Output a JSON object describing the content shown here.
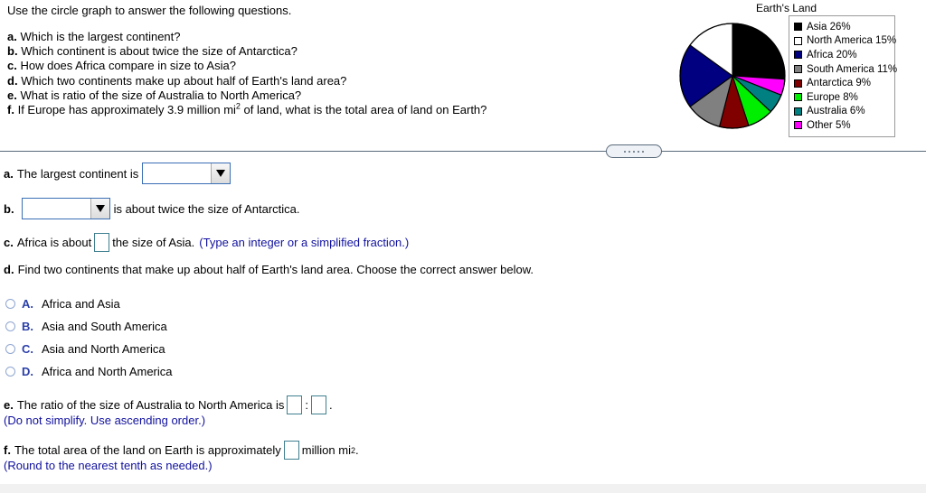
{
  "prompt": {
    "intro": "Use the circle graph to answer the following questions.",
    "questions": [
      {
        "label": "a.",
        "text": "Which is the largest continent?"
      },
      {
        "label": "b.",
        "text": "Which continent is about twice the size of Antarctica?"
      },
      {
        "label": "c.",
        "text": "How does Africa compare in size to Asia?"
      },
      {
        "label": "d.",
        "text": "Which two continents make up about half of Earth's land area?"
      },
      {
        "label": "e.",
        "text": "What is ratio of the size of Australia to North America?"
      },
      {
        "label": "f_pre",
        "text": "If Europe has approximately 3.9 million mi"
      },
      {
        "label": "f_post",
        "text": " of land, what is the total area of land on Earth?"
      }
    ],
    "f_label": "f.",
    "superscript": "2"
  },
  "chart_data": {
    "type": "pie",
    "title": "Earth's Land",
    "xlabel": "",
    "ylabel": "",
    "legend_position": "right",
    "grid": false,
    "start_angle_deg": 0,
    "direction": "clockwise",
    "categories": [
      "Asia",
      "Other",
      "Australia",
      "Europe",
      "Antarctica",
      "South America",
      "Africa",
      "North America"
    ],
    "values": [
      26,
      5,
      6,
      8,
      9,
      11,
      20,
      15
    ],
    "unit": "%",
    "legend_order": [
      "Asia",
      "North America",
      "Africa",
      "South America",
      "Antarctica",
      "Europe",
      "Australia",
      "Other"
    ],
    "legend_entries": [
      {
        "name": "Asia",
        "value": 26,
        "label": "Asia 26%",
        "color": "#000000"
      },
      {
        "name": "North America",
        "value": 15,
        "label": "North America 15%",
        "color": "#ffffff"
      },
      {
        "name": "Africa",
        "value": 20,
        "label": "Africa 20%",
        "color": "#000080"
      },
      {
        "name": "South America",
        "value": 11,
        "label": "South America 11%",
        "color": "#808080"
      },
      {
        "name": "Antarctica",
        "value": 9,
        "label": "Antarctica 9%",
        "color": "#800000"
      },
      {
        "name": "Europe",
        "value": 8,
        "label": "Europe 8%",
        "color": "#00ee00"
      },
      {
        "name": "Australia",
        "value": 6,
        "label": "Australia 6%",
        "color": "#008080"
      },
      {
        "name": "Other",
        "value": 5,
        "label": "Other 5%",
        "color": "#ff00ff"
      }
    ],
    "slices_clockwise_from_top": [
      {
        "name": "Asia",
        "value": 26,
        "color": "#000000"
      },
      {
        "name": "Other",
        "value": 5,
        "color": "#ff00ff"
      },
      {
        "name": "Australia",
        "value": 6,
        "color": "#008080"
      },
      {
        "name": "Europe",
        "value": 8,
        "color": "#00ee00"
      },
      {
        "name": "Antarctica",
        "value": 9,
        "color": "#800000"
      },
      {
        "name": "South America",
        "value": 11,
        "color": "#808080"
      },
      {
        "name": "Africa",
        "value": 20,
        "color": "#000080"
      },
      {
        "name": "North America",
        "value": 15,
        "color": "#ffffff"
      }
    ]
  },
  "answers": {
    "a": {
      "label": "a.",
      "text_before": "The largest continent is",
      "dropdown_value": ""
    },
    "b": {
      "label": "b.",
      "dropdown_value": "",
      "text_after": "is about twice the size of Antarctica."
    },
    "c": {
      "label": "c.",
      "text_before": "Africa is about",
      "input_value": "",
      "text_after": "the size of Asia.",
      "hint": "(Type an integer or a simplified fraction.)"
    },
    "d": {
      "label": "d.",
      "text": "Find two continents that make up about half of Earth's land area. Choose the correct answer below.",
      "choices": [
        {
          "letter": "A.",
          "text": "Africa and Asia",
          "selected": false
        },
        {
          "letter": "B.",
          "text": "Asia and South America",
          "selected": false
        },
        {
          "letter": "C.",
          "text": "Asia and North America",
          "selected": false
        },
        {
          "letter": "D.",
          "text": "Africa and North America",
          "selected": false
        }
      ]
    },
    "e": {
      "label": "e.",
      "text_before": "The ratio of the size of Australia to North America is",
      "input1_value": "",
      "separator": ":",
      "input2_value": "",
      "period": ".",
      "hint": "(Do not simplify. Use ascending order.)"
    },
    "f": {
      "label": "f.",
      "text_before": "The total area of the land on Earth is approximately",
      "input_value": "",
      "unit_text": "million mi",
      "unit_sup": "2",
      "period": ".",
      "hint": "(Round to the nearest tenth as needed.)"
    }
  },
  "divider": {
    "handle_dots": 5
  }
}
